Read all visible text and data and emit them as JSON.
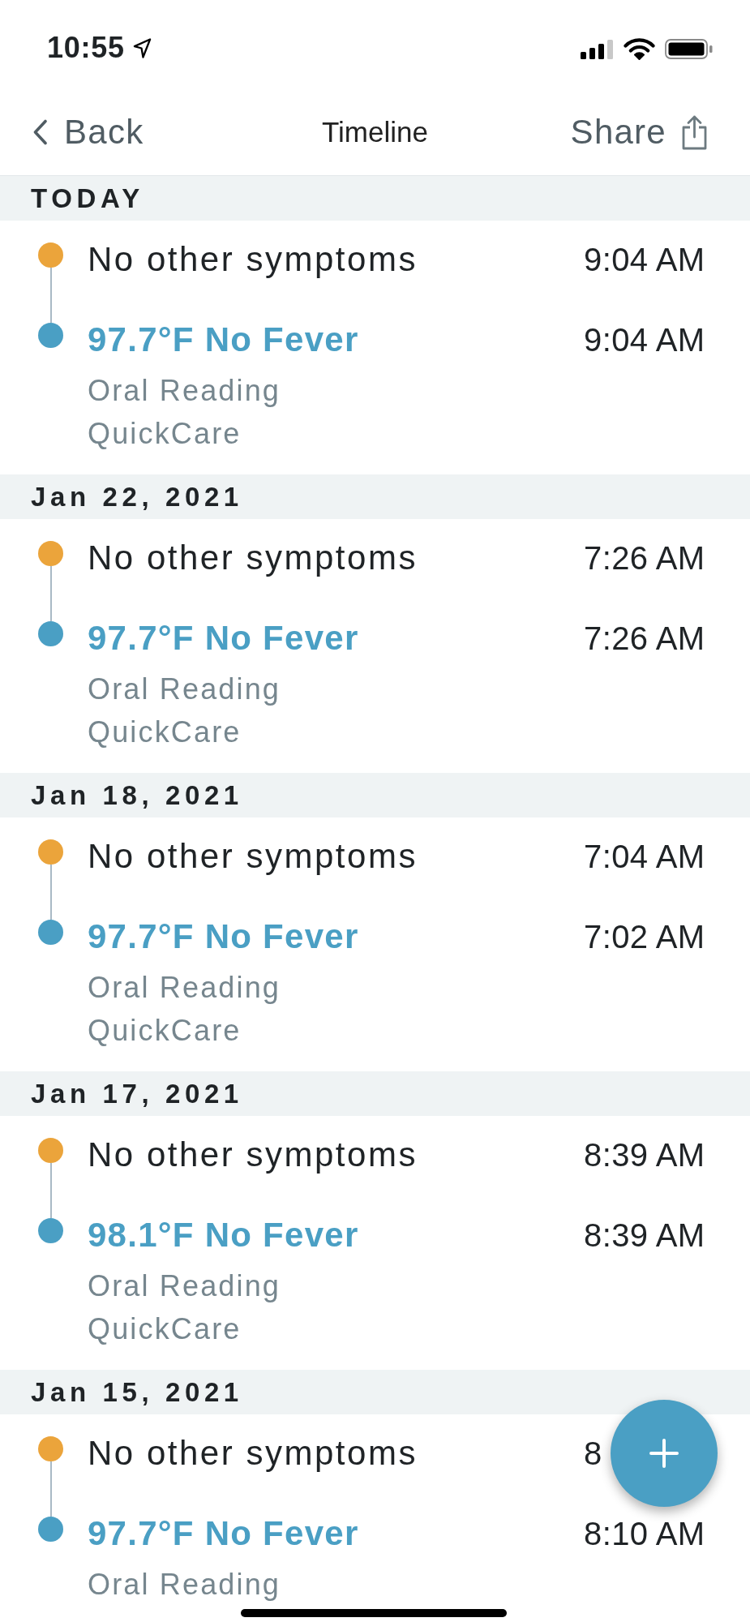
{
  "status_bar": {
    "time": "10:55"
  },
  "nav": {
    "back": "Back",
    "title": "Timeline",
    "share": "Share"
  },
  "sections": [
    {
      "date": "TODAY",
      "events": [
        {
          "kind": "symptom",
          "color": "#eba43b",
          "title": "No other symptoms",
          "time": "9:04 AM"
        },
        {
          "kind": "temperature",
          "color": "#4a9fc4",
          "title": "97.7°F No Fever",
          "details": [
            "Oral Reading",
            "QuickCare"
          ],
          "time": "9:04 AM"
        }
      ]
    },
    {
      "date": "Jan 22, 2021",
      "events": [
        {
          "kind": "symptom",
          "color": "#eba43b",
          "title": "No other symptoms",
          "time": "7:26 AM"
        },
        {
          "kind": "temperature",
          "color": "#4a9fc4",
          "title": "97.7°F No Fever",
          "details": [
            "Oral Reading",
            "QuickCare"
          ],
          "time": "7:26 AM"
        }
      ]
    },
    {
      "date": "Jan 18, 2021",
      "events": [
        {
          "kind": "symptom",
          "color": "#eba43b",
          "title": "No other symptoms",
          "time": "7:04 AM"
        },
        {
          "kind": "temperature",
          "color": "#4a9fc4",
          "title": "97.7°F No Fever",
          "details": [
            "Oral Reading",
            "QuickCare"
          ],
          "time": "7:02 AM"
        }
      ]
    },
    {
      "date": "Jan 17, 2021",
      "events": [
        {
          "kind": "symptom",
          "color": "#eba43b",
          "title": "No other symptoms",
          "time": "8:39 AM"
        },
        {
          "kind": "temperature",
          "color": "#4a9fc4",
          "title": "98.1°F No Fever",
          "details": [
            "Oral Reading",
            "QuickCare"
          ],
          "time": "8:39 AM"
        }
      ]
    },
    {
      "date": "Jan 15, 2021",
      "events": [
        {
          "kind": "symptom",
          "color": "#eba43b",
          "title": "No other symptoms",
          "time": "8"
        },
        {
          "kind": "temperature",
          "color": "#4a9fc4",
          "title": "97.7°F No Fever",
          "details": [
            "Oral Reading"
          ],
          "time": "8:10 AM"
        }
      ]
    }
  ]
}
